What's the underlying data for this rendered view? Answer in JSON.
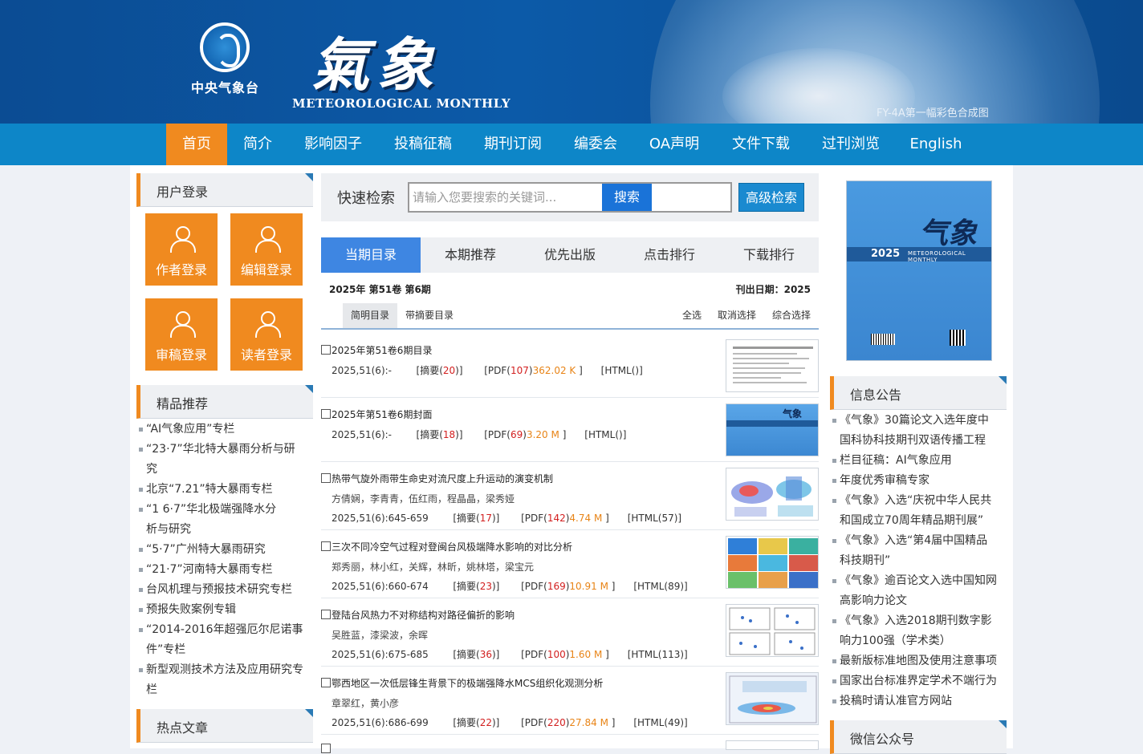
{
  "header": {
    "org_name": "中央气象台",
    "brand_cn": "氣象",
    "brand_en": "METEOROLOGICAL MONTHLY",
    "image_caption": "FY-4A第一幅彩色合成图"
  },
  "nav": {
    "items": [
      "首页",
      "简介",
      "影响因子",
      "投稿征稿",
      "期刊订阅",
      "编委会",
      "OA声明",
      "文件下载",
      "过刊浏览",
      "English"
    ]
  },
  "left": {
    "login_title": "用户登录",
    "logins": [
      {
        "label": "作者登录",
        "icon": "author-icon"
      },
      {
        "label": "编辑登录",
        "icon": "editor-icon"
      },
      {
        "label": "审稿登录",
        "icon": "reviewer-icon"
      },
      {
        "label": "读者登录",
        "icon": "reader-icon"
      }
    ],
    "featured_title": "精品推荐",
    "featured": [
      "“AI气象应用”专栏",
      "“23·7”华北特大暴雨分析与研",
      "究",
      "北京“7.21”特大暴雨专栏",
      "“1 6·7”华北极端强降水分",
      "析与研究",
      "“5·7”广州特大暴雨研究",
      "“21·7”河南特大暴雨专栏",
      "台风机理与预报技术研究专栏",
      "预报失败案例专辑",
      "“2014-2016年超强厄尔尼诺事",
      "件”专栏",
      "新型观测技术方法及应用研究专",
      "栏"
    ],
    "hot_title": "热点文章"
  },
  "center": {
    "search": {
      "label": "快速检索",
      "placeholder": "请输入您要搜索的关键词...",
      "button": "搜索",
      "advanced": "高级检索"
    },
    "tabs": [
      "当期目录",
      "本期推荐",
      "优先出版",
      "点击排行",
      "下载排行"
    ],
    "issue": "2025年 第51卷 第6期",
    "pub_date": "刊出日期：2025",
    "sub_tabs": [
      "简明目录",
      "带摘要目录"
    ],
    "actions": [
      "全选",
      "取消选择",
      "综合选择"
    ],
    "articles": [
      {
        "title": "2025年第51卷6期目录",
        "authors": "",
        "cite": "2025,51(6):-",
        "abs_label": "[摘要(",
        "abs_count": "20",
        "abs_close": ")]",
        "pdf_label": "[PDF(",
        "pdf_count": "107",
        "pdf_close": ")",
        "pdf_size": "362.02 K",
        "pdf_end": "]",
        "html": "[HTML()]"
      },
      {
        "title": "2025年第51卷6期封面",
        "authors": "",
        "cite": "2025,51(6):-",
        "abs_label": "[摘要(",
        "abs_count": "18",
        "abs_close": ")]",
        "pdf_label": "[PDF(",
        "pdf_count": "69",
        "pdf_close": ")",
        "pdf_size": "3.20 M",
        "pdf_end": "]",
        "html": "[HTML()]"
      },
      {
        "title": "热带气旋外雨带生命史对流尺度上升运动的演变机制",
        "authors": "方倩娴，李青青，伍红雨，程晶晶，梁秀娅",
        "cite": "2025,51(6):645-659",
        "abs_label": "[摘要(",
        "abs_count": "17",
        "abs_close": ")]",
        "pdf_label": "[PDF(",
        "pdf_count": "142",
        "pdf_close": ")",
        "pdf_size": "4.74 M",
        "pdf_end": "]",
        "html": "[HTML(57)]"
      },
      {
        "title": "三次不同冷空气过程对登闽台风极端降水影响的对比分析",
        "authors": "郑秀丽，林小红，关辉，林昕，姚林塔，梁宝元",
        "cite": "2025,51(6):660-674",
        "abs_label": "[摘要(",
        "abs_count": "23",
        "abs_close": ")]",
        "pdf_label": "[PDF(",
        "pdf_count": "169",
        "pdf_close": ")",
        "pdf_size": "10.91 M",
        "pdf_end": "]",
        "html": "[HTML(89)]"
      },
      {
        "title": "登陆台风热力不对称结构对路径偏折的影响",
        "authors": "吴胜蓝，漆梁波，余晖",
        "cite": "2025,51(6):675-685",
        "abs_label": "[摘要(",
        "abs_count": "36",
        "abs_close": ")]",
        "pdf_label": "[PDF(",
        "pdf_count": "100",
        "pdf_close": ")",
        "pdf_size": "1.60 M",
        "pdf_end": "]",
        "html": "[HTML(113)]"
      },
      {
        "title": "鄂西地区一次低层锋生背景下的极端强降水MCS组织化观测分析",
        "authors": "章翠红，黄小彦",
        "cite": "2025,51(6):686-699",
        "abs_label": "[摘要(",
        "abs_count": "22",
        "abs_close": ")]",
        "pdf_label": "[PDF(",
        "pdf_count": "220",
        "pdf_close": ")",
        "pdf_size": "27.84 M",
        "pdf_end": "]",
        "html": "[HTML(49)]"
      }
    ]
  },
  "right": {
    "cover": {
      "title": "气象",
      "year": "2025",
      "en": "METEOROLOGICAL MONTHLY"
    },
    "notice_title": "信息公告",
    "notices": [
      "《气象》30篇论文入选年度中",
      "国科协科技期刊双语传播工程",
      "栏目征稿：AI气象应用",
      "年度优秀审稿专家",
      "《气象》入选“庆祝中华人民共",
      "和国成立70周年精品期刊展”",
      "《气象》入选“第4届中国精品",
      "科技期刊”",
      "《气象》逾百论文入选中国知网",
      "高影响力论文",
      "《气象》入选2018期刊数字影",
      "响力100强（学术类）",
      "最新版标准地图及使用注意事项",
      "国家出台标准界定学术不端行为",
      "投稿时请认准官方网站"
    ],
    "wechat_title": "微信公众号"
  },
  "colors": {
    "accent_orange": "#f08a1f",
    "nav_blue": "#0d86c8",
    "tab_blue": "#3e86e2",
    "count_red": "#d21f1f",
    "size_orange": "#e88417"
  }
}
